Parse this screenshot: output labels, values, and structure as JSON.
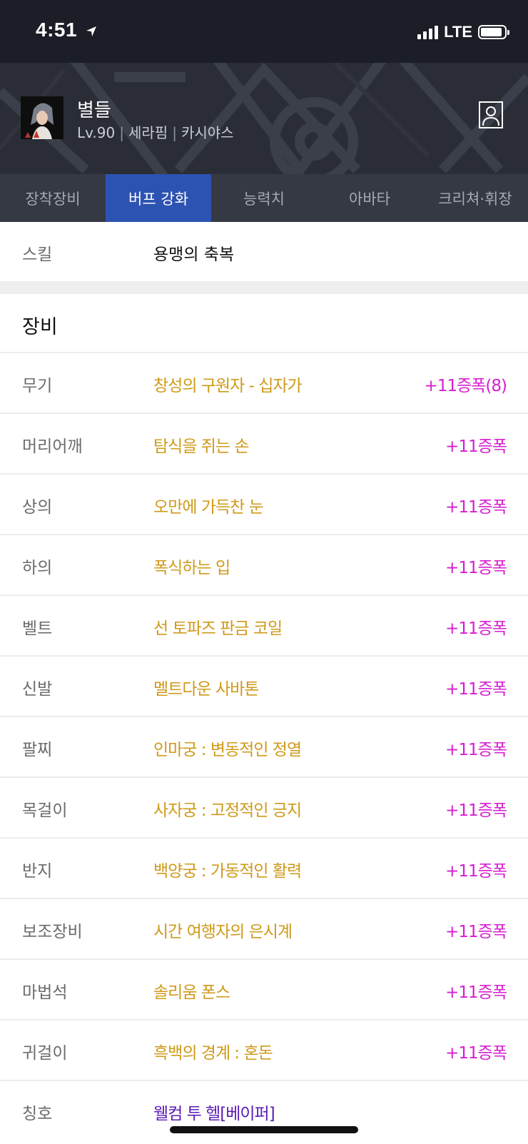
{
  "status_bar": {
    "time": "4:51",
    "network": "LTE",
    "signal_bars": 4,
    "battery_level": 0.9,
    "icons": [
      "location-arrow-icon",
      "cell-signal-icon",
      "battery-icon"
    ]
  },
  "character": {
    "name": "별들",
    "level": "Lv.90",
    "class": "세라핌",
    "server": "카시야스",
    "separator": "|"
  },
  "tabs": [
    {
      "label": "장착장비",
      "active": false
    },
    {
      "label": "버프 강화",
      "active": true
    },
    {
      "label": "능력치",
      "active": false
    },
    {
      "label": "아바타",
      "active": false
    },
    {
      "label": "크리쳐·휘장",
      "active": false
    }
  ],
  "skill": {
    "label": "스킬",
    "value": "용맹의 축복"
  },
  "equipment": {
    "title": "장비",
    "items": [
      {
        "slot": "무기",
        "name": "창성의 구원자 - 십자가",
        "enhance": "+11증폭(8)"
      },
      {
        "slot": "머리어깨",
        "name": "탐식을 쥐는 손",
        "enhance": "+11증폭"
      },
      {
        "slot": "상의",
        "name": "오만에 가득찬 눈",
        "enhance": "+11증폭"
      },
      {
        "slot": "하의",
        "name": "폭식하는 입",
        "enhance": "+11증폭"
      },
      {
        "slot": "벨트",
        "name": "선 토파즈 판금 코일",
        "enhance": "+11증폭"
      },
      {
        "slot": "신발",
        "name": "멜트다운 사바톤",
        "enhance": "+11증폭"
      },
      {
        "slot": "팔찌",
        "name": "인마궁 : 변동적인 정열",
        "enhance": "+11증폭"
      },
      {
        "slot": "목걸이",
        "name": "사자궁 : 고정적인 긍지",
        "enhance": "+11증폭"
      },
      {
        "slot": "반지",
        "name": "백양궁 : 가동적인 활력",
        "enhance": "+11증폭"
      },
      {
        "slot": "보조장비",
        "name": "시간 여행자의 은시계",
        "enhance": "+11증폭"
      },
      {
        "slot": "마법석",
        "name": "솔리움 폰스",
        "enhance": "+11증폭"
      },
      {
        "slot": "귀걸이",
        "name": "흑백의 경계 : 혼돈",
        "enhance": "+11증폭"
      },
      {
        "slot": "칭호",
        "name": "웰컴 투 헬[베이퍼]",
        "enhance": ""
      }
    ]
  },
  "colors": {
    "status_bg": "#1b1e26",
    "header_bg": "#2a2d36",
    "tab_bg": "#353944",
    "tab_active": "#2d53b2",
    "item_gold": "#cf9a19",
    "item_purple": "#5a1bb5",
    "enhance_magenta": "#d61fd0"
  }
}
